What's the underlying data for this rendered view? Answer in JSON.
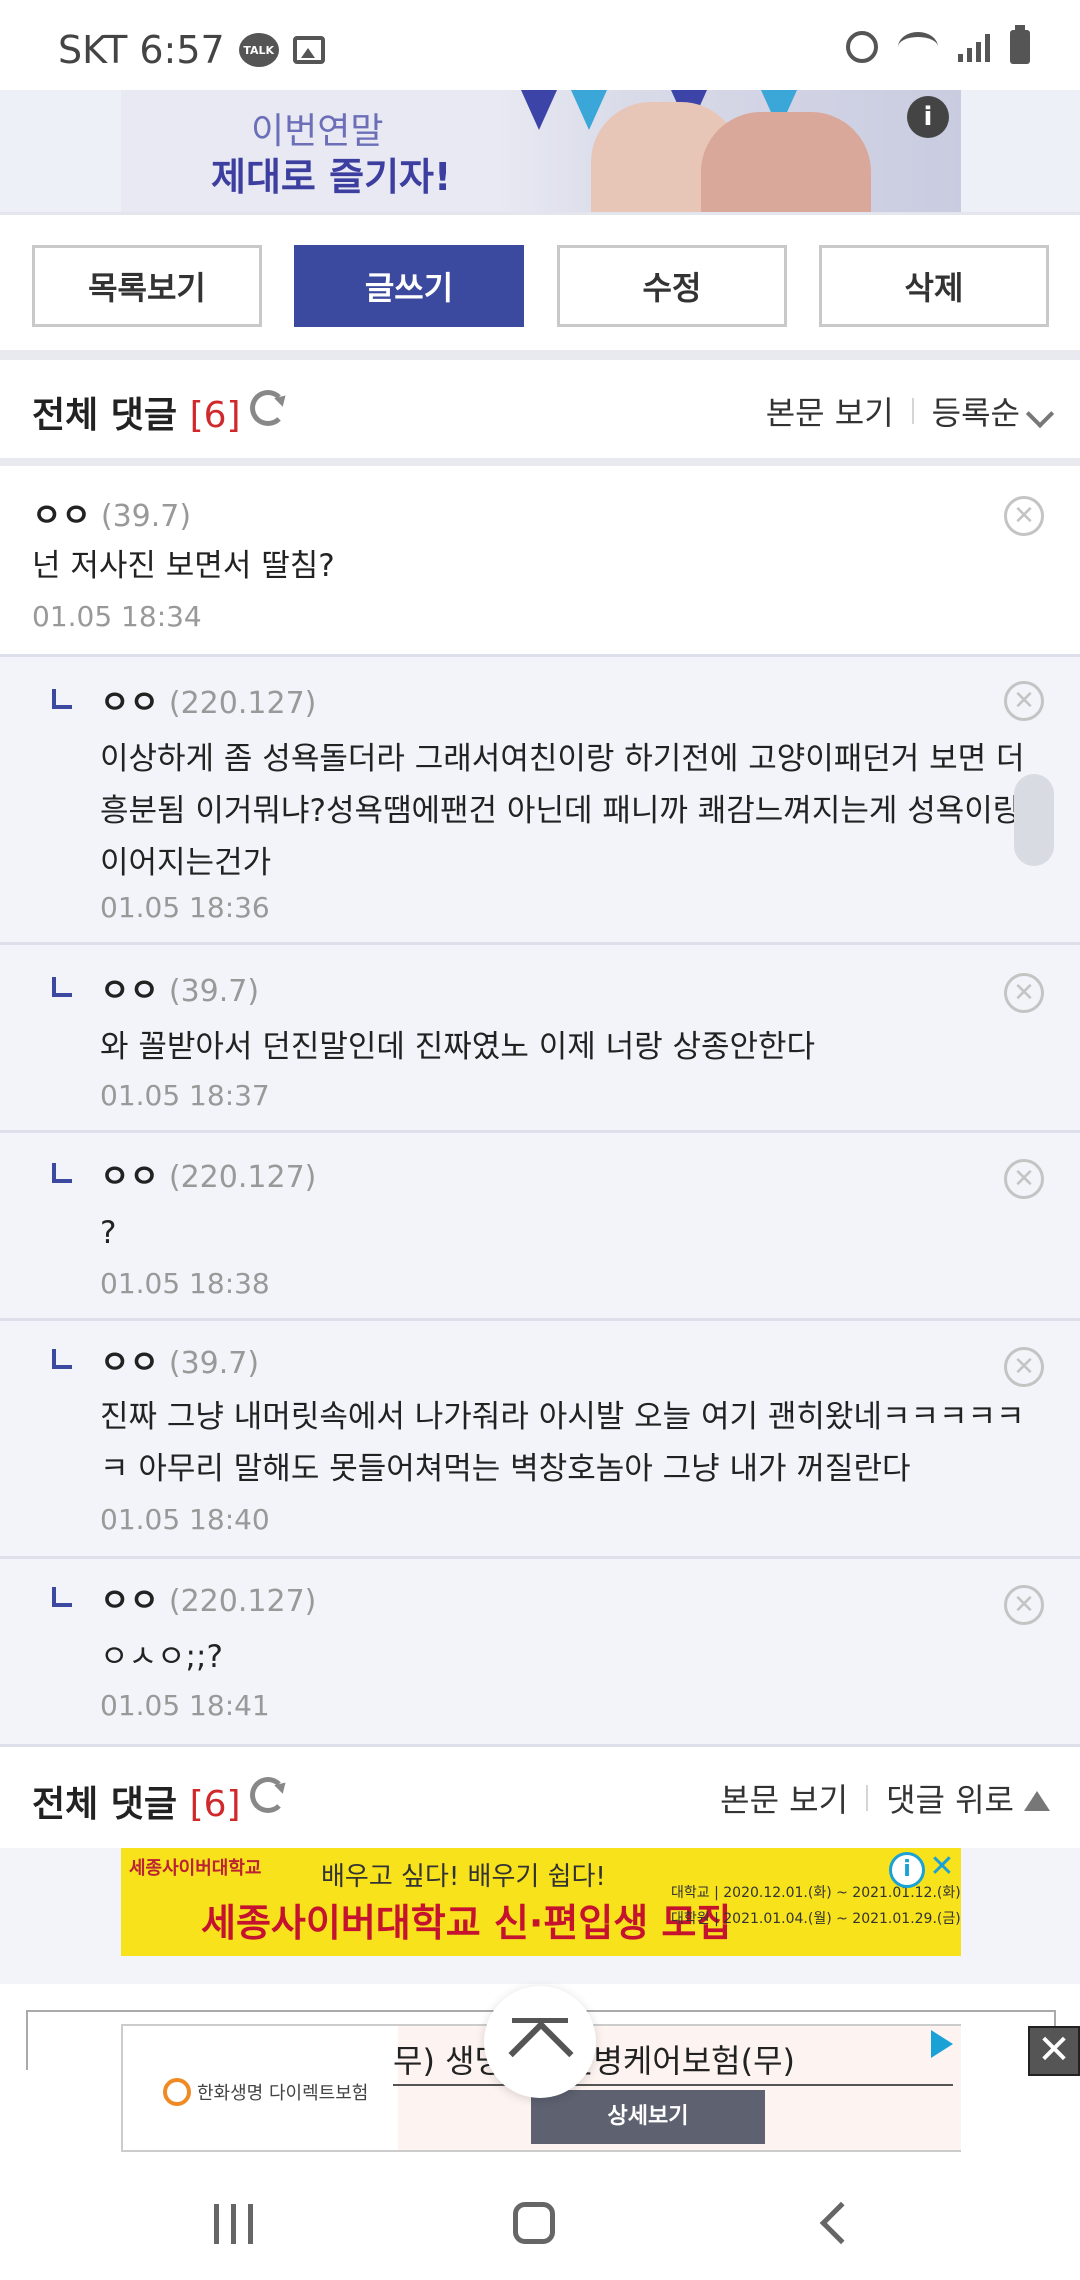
{
  "status_bar": {
    "carrier_time": "SKT 6:57",
    "talk_badge": "TALK"
  },
  "top_ad": {
    "line1": "이번연말",
    "line2": "제대로 즐기자!",
    "info_icon": "i"
  },
  "actions": {
    "list": "목록보기",
    "write": "글쓰기",
    "edit": "수정",
    "delete": "삭제"
  },
  "comments_header_top": {
    "title": "전체 댓글",
    "count": "[6]",
    "view_body": "본문 보기",
    "sort": "등록순"
  },
  "comments": [
    {
      "nick": "ㅇㅇ",
      "ip": "(39.7)",
      "text": "넌 저사진 보면서 딸침?",
      "time": "01.05 18:34",
      "reply": false
    },
    {
      "nick": "ㅇㅇ",
      "ip": "(220.127)",
      "text": "이상하게 좀 성욕돌더라 그래서여친이랑 하기전에 고양이패던거 보면 더흥분됨 이거뭐냐?성욕땜에팬건 아닌데 패니까 쾌감느껴지는게 성욕이랑이어지는건가",
      "time": "01.05 18:36",
      "reply": true
    },
    {
      "nick": "ㅇㅇ",
      "ip": "(39.7)",
      "text": "와 꼴받아서 던진말인데 진짜였노 이제 너랑 상종안한다",
      "time": "01.05 18:37",
      "reply": true
    },
    {
      "nick": "ㅇㅇ",
      "ip": "(220.127)",
      "text": "?",
      "time": "01.05 18:38",
      "reply": true
    },
    {
      "nick": "ㅇㅇ",
      "ip": "(39.7)",
      "text": "진짜 그냥 내머릿속에서 나가줘라 아시발 오늘 여기 괜히왔네ㅋㅋㅋㅋㅋㅋ 아무리 말해도 못들어쳐먹는 벽창호놈아 그냥 내가 꺼질란다",
      "time": "01.05 18:40",
      "reply": true
    },
    {
      "nick": "ㅇㅇ",
      "ip": "(220.127)",
      "text": "ㅇㅅㅇ;;?",
      "time": "01.05 18:41",
      "reply": true
    }
  ],
  "comments_header_bottom": {
    "title": "전체 댓글",
    "count": "[6]",
    "view_body": "본문 보기",
    "to_top": "댓글 위로"
  },
  "sejong_ad": {
    "brand": "세종사이버대학교",
    "slogan": "배우고 싶다! 배우기 쉽다!",
    "headline": "세종사이버대학교 신·편입생 모집",
    "date1": "대학교 | 2020.12.01.(화) ~ 2021.01.12.(화)",
    "date2": "대학원 | 2021.01.04.(월) ~ 2021.01.29.(금)"
  },
  "hanwha_ad": {
    "logo": "한화생명 다이렉트보험",
    "product": "무)    생명 3대질병케어보험(무)",
    "detail": "상세보기"
  },
  "colors": {
    "primary": "#3b4a9e",
    "count_red": "#d0292b",
    "reply_bg": "#f3f4f9"
  }
}
